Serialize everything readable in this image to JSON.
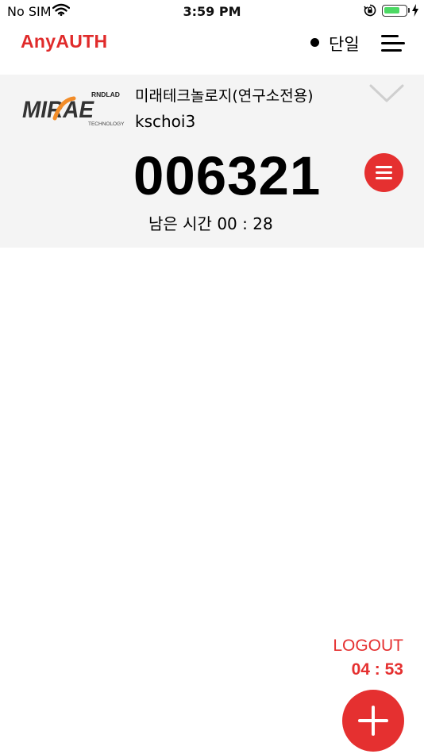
{
  "status_bar": {
    "carrier": "No SIM",
    "time": "3:59 PM",
    "battery_level": 0.75,
    "battery_color": "#4cd964"
  },
  "header": {
    "logo": "AnyAUTH",
    "mode_label": "단일",
    "accent_color": "#e02b2b"
  },
  "account": {
    "company_logo": {
      "top_text": "RNDLAD",
      "main_text": "MIRAE",
      "sub_text": "TECHNOLOGY"
    },
    "name": "미래테크놀로지(연구소전용)",
    "user": "kschoi3",
    "otp_code": "006321",
    "remaining_label": "남은 시간 00 : 28"
  },
  "footer": {
    "logout_label": "LOGOUT",
    "logout_timer": "04 : 53"
  },
  "icons": {
    "wifi": "wifi-icon",
    "lock": "orientation-lock-icon",
    "charging": "charging-bolt-icon",
    "menu": "hamburger-menu-icon",
    "expand": "chevron-down-icon",
    "otp_menu": "list-menu-icon",
    "add": "plus-icon"
  }
}
